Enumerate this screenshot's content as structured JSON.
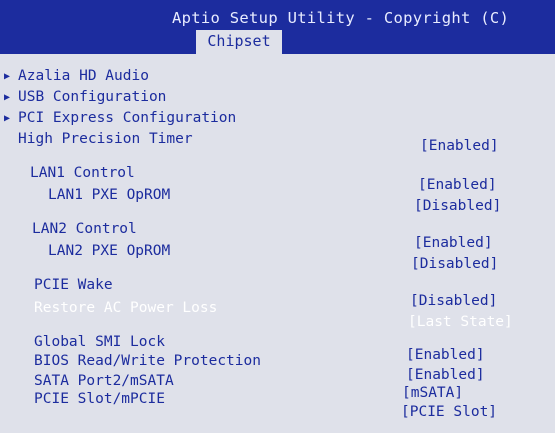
{
  "header": {
    "title": "Aptio Setup Utility - Copyright (C)",
    "active_tab": "Chipset"
  },
  "icons": {
    "submenu_arrow": "triangle-right-icon"
  },
  "colors": {
    "header_bg": "#1c2c9e",
    "panel_bg": "#dfe1ea",
    "text": "#1c2c9e",
    "highlight_text": "#ffffff"
  },
  "menu": {
    "azalia": "Azalia HD Audio",
    "usb": "USB Configuration",
    "pcie_config": "PCI Express Configuration"
  },
  "settings": {
    "hpet_label": "High Precision Timer",
    "hpet_value": "[Enabled]",
    "lan1_label": "LAN1 Control",
    "lan1_value": "[Enabled]",
    "lan1_pxe_label": "LAN1 PXE OpROM",
    "lan1_pxe_value": "[Disabled]",
    "lan2_label": "LAN2 Control",
    "lan2_value": "[Enabled]",
    "lan2_pxe_label": "LAN2 PXE OpROM",
    "lan2_pxe_value": "[Disabled]",
    "pcie_wake_label": "PCIE Wake",
    "pcie_wake_value": "[Disabled]",
    "restore_ac_label": "Restore AC Power Loss",
    "restore_ac_value": "[Last State]",
    "global_smi_label": "Global SMI Lock",
    "global_smi_value": "[Enabled]",
    "bios_rw_label": "BIOS Read/Write Protection",
    "bios_rw_value": "[Enabled]",
    "sata_label": "SATA Port2/mSATA",
    "sata_value": "[mSATA]",
    "pcie_slot_label": "PCIE Slot/mPCIE",
    "pcie_slot_value": "[PCIE Slot]"
  }
}
